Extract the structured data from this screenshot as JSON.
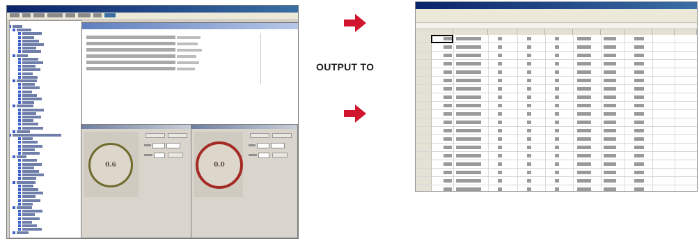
{
  "middle": {
    "output_label": "OUTPUT TO",
    "arrow_color": "#d1152e"
  },
  "left_screenshot": {
    "gauges": [
      {
        "value": "0.6",
        "ring_color": "#6f6a2c"
      },
      {
        "value": "0.0",
        "ring_color": "#a52a24"
      }
    ]
  },
  "right_screenshot": {
    "app": "spreadsheet"
  }
}
